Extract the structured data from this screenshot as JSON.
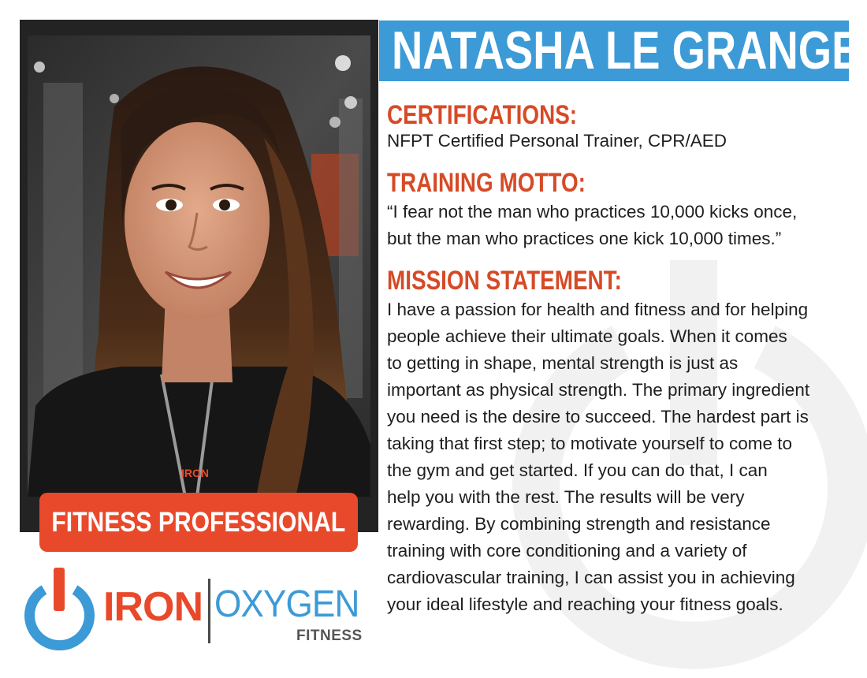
{
  "profile": {
    "name": "NATASHA LE GRANGE",
    "role": "FITNESS PROFESSIONAL"
  },
  "sections": {
    "certifications": {
      "heading": "CERTIFICATIONS:",
      "text": "NFPT Certified Personal Trainer, CPR/AED"
    },
    "motto": {
      "heading": "TRAINING MOTTO:",
      "line1": "“I fear not the man who practices 10,000 kicks once,",
      "line2": "but the man who practices one kick 10,000 times.”"
    },
    "mission": {
      "heading": "MISSION STATEMENT:",
      "lines": [
        "I have a passion for health and fitness and for helping",
        "people achieve their ultimate goals. When it comes",
        "to getting in shape, mental strength is just as",
        "important as physical strength. The primary ingredient",
        "you need is the desire to succeed. The hardest part is",
        "taking that first step; to motivate yourself to come to",
        "the gym and get started. If you can do that, I can",
        "help you with the rest. The results will be very",
        "rewarding. By combining strength and resistance",
        "training with core conditioning and a variety of",
        "cardiovascular training, I can assist you in achieving",
        "your ideal lifestyle and reaching your fitness goals."
      ]
    }
  },
  "logo": {
    "word1": "IRON",
    "word2": "OXYGEN",
    "subtitle": "FITNESS",
    "icon": "power-icon"
  },
  "colors": {
    "accent_orange": "#e9492b",
    "heading_orange": "#d64a26",
    "brand_blue": "#3c9ad6",
    "frame_dark": "#232323"
  }
}
